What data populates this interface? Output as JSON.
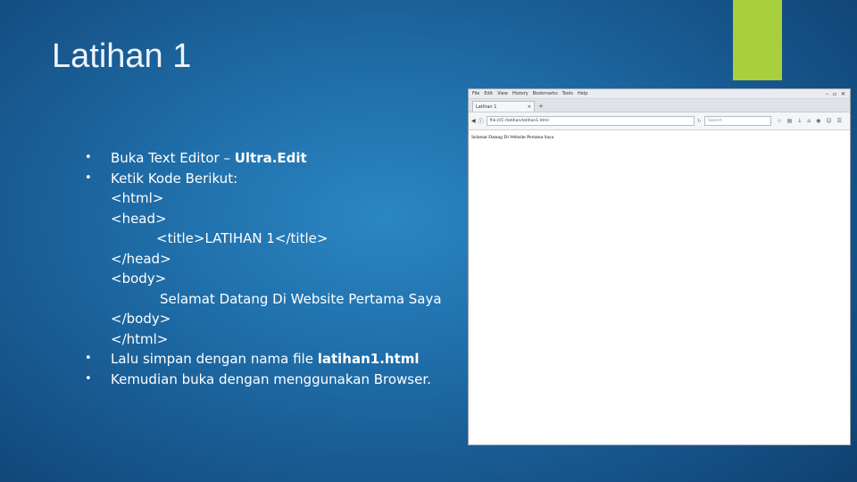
{
  "slide": {
    "title": "Latihan 1",
    "accent_color": "#a8cf3c"
  },
  "bullets": {
    "b1_text": "Buka Text Editor – ",
    "b1_bold": "Ultra.Edit",
    "b2_text": "Ketik Kode Berikut:",
    "code": {
      "l1": "<html>",
      "l2": "<head>",
      "l3": "<title>LATIHAN 1</title>",
      "l4": "</head>",
      "l5": "<body>",
      "l6": "Selamat Datang Di Website Pertama Saya",
      "l7": "</body>",
      "l8": "</html>"
    },
    "b3_text": "Lalu simpan dengan nama file ",
    "b3_bold": "latihan1.html",
    "b4_text": "Kemudian buka dengan menggunakan Browser.",
    "marker": "•"
  },
  "browser": {
    "menu": [
      "File",
      "Edit",
      "View",
      "History",
      "Bookmarks",
      "Tools",
      "Help"
    ],
    "window_controls": [
      "–",
      "▫",
      "✕"
    ],
    "tab_title": "Latihan 1",
    "tab_close": "×",
    "tab_new": "+",
    "url": "file:///C:/latihan/latihan1.html",
    "search_placeholder": "Search",
    "page_text": "Selamat Datang Di Website Pertama Saya"
  }
}
